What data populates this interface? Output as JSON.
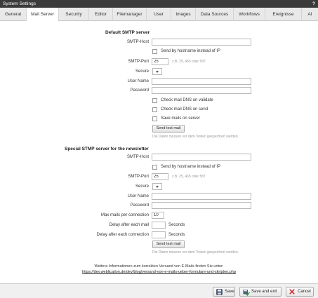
{
  "window": {
    "title": "System Settings",
    "help": "?"
  },
  "tabs": [
    {
      "label": "General"
    },
    {
      "label": "Mail Server",
      "active": true
    },
    {
      "label": "Security"
    },
    {
      "label": "Editor"
    },
    {
      "label": "Filemanager"
    },
    {
      "label": "User"
    },
    {
      "label": "Images"
    },
    {
      "label": "Data Sources"
    },
    {
      "label": "Workflows"
    },
    {
      "label": "Ereignisse"
    },
    {
      "label": "AI"
    }
  ],
  "default_smtp": {
    "heading": "Default SMTP server",
    "host_label": "SMTP-Host",
    "host_value": "",
    "send_by_hostname_label": "Send by hostname instead of IP",
    "port_label": "SMTP-Port",
    "port_value": "25",
    "port_hint": "z.B. 25, 465 oder 587",
    "secure_label": "Secure",
    "user_label": "User Name",
    "user_value": "",
    "password_label": "Password",
    "password_value": "",
    "check_dns_validate_label": "Check mail DNS on validate",
    "check_dns_send_label": "Check mail DNS on send",
    "save_mails_label": "Save mails on server",
    "test_button": "Send test mail",
    "test_hint": "Die Daten müssen vor dem Testen gespeichert werden."
  },
  "newsletter_smtp": {
    "heading": "Special STMP server for the newsletter",
    "host_label": "SMTP-Host",
    "host_value": "",
    "send_by_hostname_label": "Send by hostname instead of IP",
    "port_label": "SMTP-Port",
    "port_value": "25",
    "port_hint": "z.B. 25, 465 oder 587",
    "secure_label": "Secure",
    "user_label": "User Name",
    "user_value": "",
    "password_label": "Password",
    "password_value": "",
    "max_mails_label": "Max mails per connection",
    "max_mails_value": "10",
    "delay_mail_label": "Delay after each mail",
    "delay_mail_value": "",
    "delay_mail_unit": "Seconds",
    "delay_conn_label": "Delay after each connection",
    "delay_conn_value": "",
    "delay_conn_unit": "Seconds",
    "test_button": "Send test mail",
    "test_hint": "Die Daten müssen vor dem Testen gespeichert werden."
  },
  "info": {
    "text": "Weitere Informationen zum korrekten Versand von E-Mails finden Sie unter:",
    "link": "https://dev.weblication.de/dev/blog/versand-von-e-mails-ueber-formulare-und-skripten.php"
  },
  "footer": {
    "save": "Save",
    "save_exit": "Save and exit",
    "cancel": "Cancel"
  }
}
